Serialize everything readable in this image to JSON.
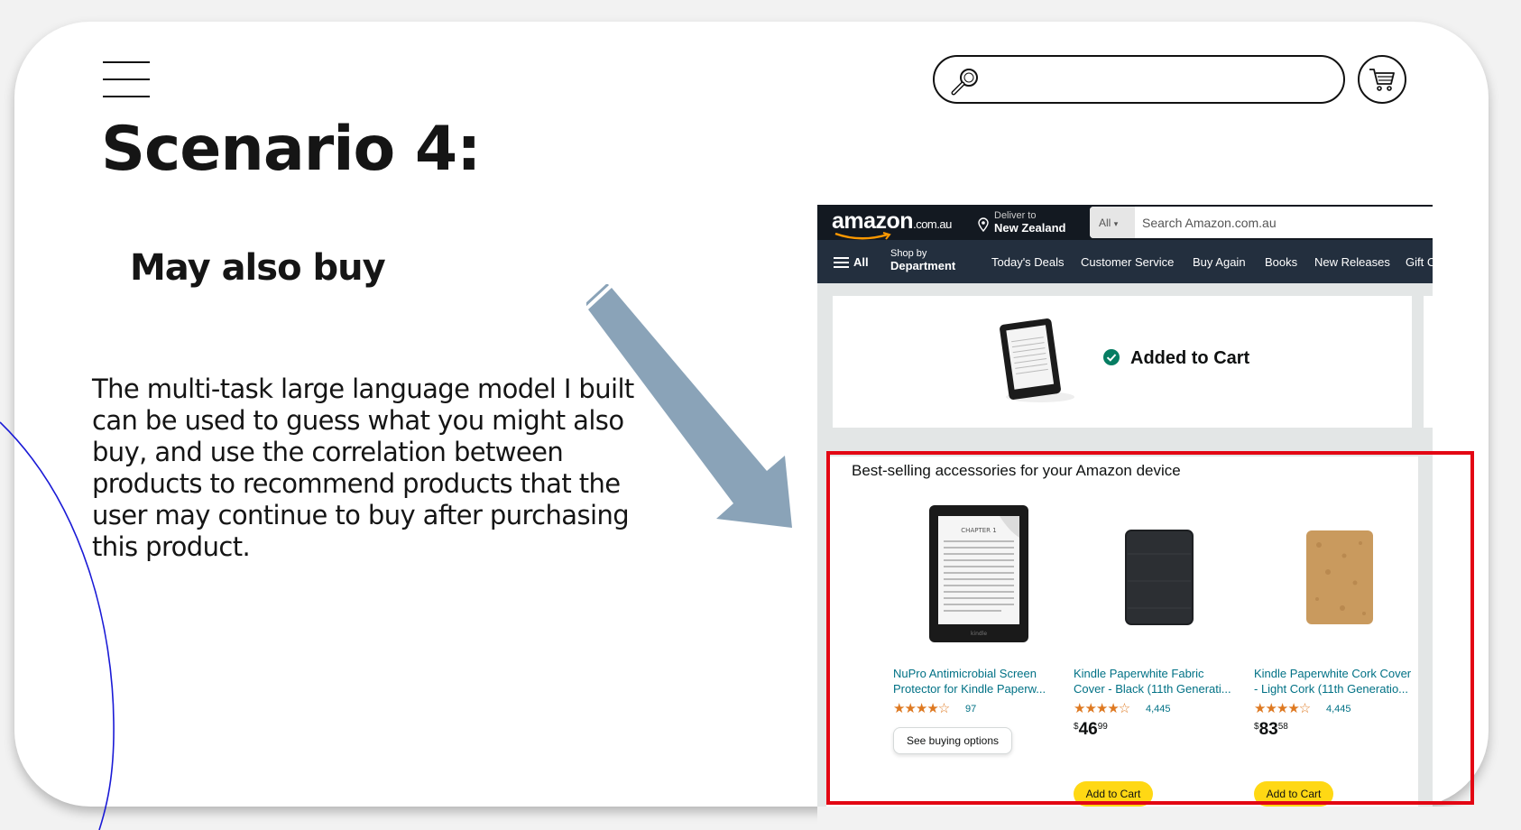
{
  "slide": {
    "title": "Scenario 4:",
    "subtitle": "May also buy",
    "body": "The multi-task large language model I built can be used to guess what you might also buy, and use the correlation between products to recommend products that the user may continue to buy after purchasing this product."
  },
  "amazon": {
    "logo": "amazon",
    "logo_suffix": ".com.au",
    "deliver_label": "Deliver to",
    "deliver_location": "New Zealand",
    "search_category": "All",
    "search_placeholder": "Search Amazon.com.au",
    "nav": {
      "all": "All",
      "shop_by": "Shop by",
      "department": "Department",
      "links": [
        "Today's Deals",
        "Customer Service",
        "Buy Again",
        "Books",
        "New Releases",
        "Gift C"
      ]
    },
    "added_to_cart": "Added to Cart",
    "recommendations_title": "Best-selling accessories for your Amazon device",
    "products": [
      {
        "name_line1": "NuPro Antimicrobial Screen",
        "name_line2": "Protector for Kindle Paperw...",
        "stars": "★★★★☆",
        "rating_count": "97",
        "button": "See buying options"
      },
      {
        "name_line1": "Kindle Paperwhite Fabric",
        "name_line2": "Cover - Black (11th Generati...",
        "stars": "★★★★☆",
        "rating_count": "4,445",
        "price_currency": "$",
        "price_whole": "46",
        "price_fraction": "99",
        "button": "Add to Cart"
      },
      {
        "name_line1": "Kindle Paperwhite Cork Cover",
        "name_line2": "- Light Cork (11th Generatio...",
        "stars": "★★★★☆",
        "rating_count": "4,445",
        "price_currency": "$",
        "price_whole": "83",
        "price_fraction": "58",
        "button": "Add to Cart"
      }
    ]
  },
  "colors": {
    "arrow": "#8aa3b8",
    "highlight_frame": "#e30613",
    "amazon_header": "#131921",
    "amazon_nav": "#232f3e",
    "add_to_cart_button": "#ffd814",
    "link": "#007185",
    "star": "#de7921"
  }
}
